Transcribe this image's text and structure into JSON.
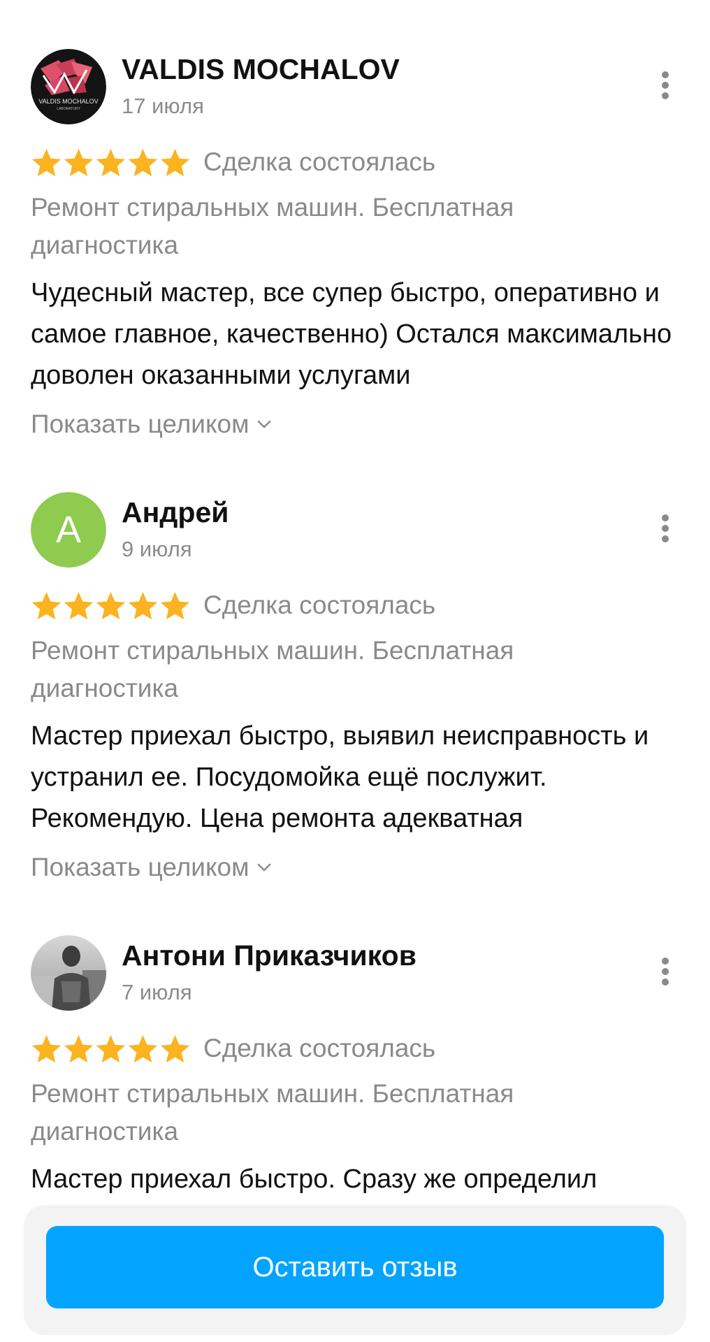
{
  "colors": {
    "star": "#fbb320",
    "button": "#02a4ff",
    "muted_text": "#8a8a8a",
    "avatar_green": "#8fcb4e"
  },
  "reviews": [
    {
      "author": "VALDIS MOCHALOV",
      "date": "17 июля",
      "avatar": {
        "type": "logo",
        "logo_text": "VALDIS MOCHALOV",
        "logo_subtext": "LABORATORY"
      },
      "rating": 5,
      "deal_status": "Сделка состоялась",
      "service": "Ремонт стиральных машин. Бесплатная диагностика",
      "text": "Чудесный мастер, все супер быстро, оперативно и самое главное, качественно) Остался максимально доволен оказанными услугами",
      "show_all": "Показать целиком"
    },
    {
      "author": "Андрей",
      "date": "9 июля",
      "avatar": {
        "type": "letter",
        "letter": "А"
      },
      "rating": 5,
      "deal_status": "Сделка состоялась",
      "service": "Ремонт стиральных машин. Бесплатная диагностика",
      "text": "Мастер приехал быстро, выявил неисправность и устранил ее. Посудомойка ещё послужит. Рекомендую. Цена ремонта адекватная",
      "show_all": "Показать целиком"
    },
    {
      "author": "Антони Приказчиков",
      "date": "7 июля",
      "avatar": {
        "type": "photo"
      },
      "rating": 5,
      "deal_status": "Сделка состоялась",
      "service": "Ремонт стиральных машин. Бесплатная диагностика",
      "text": "Мастер приехал быстро. Сразу же определил"
    }
  ],
  "leave_review_button": "Оставить отзыв",
  "icons": {
    "more": "more-vertical-icon",
    "star": "star-icon",
    "chevron": "chevron-down-icon"
  }
}
